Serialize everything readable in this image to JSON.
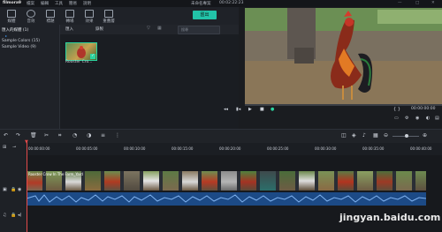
{
  "titlebar": {
    "brand": "filmora9",
    "menus": [
      "檔案",
      "編輯",
      "工具",
      "簡易",
      "說明"
    ],
    "project": "未命名專案",
    "timecode": "00:02:22:23"
  },
  "toolbar": {
    "items": [
      {
        "label": "媒體",
        "icon": "folder-icon"
      },
      {
        "label": "音效",
        "icon": "music-icon"
      },
      {
        "label": "標題",
        "icon": "text-icon"
      },
      {
        "label": "轉場",
        "icon": "transition-icon"
      },
      {
        "label": "效果",
        "icon": "effects-icon"
      },
      {
        "label": "重疊層",
        "icon": "overlay-icon"
      }
    ],
    "export_label": "匯出"
  },
  "tree": {
    "header": "匯入的媒體 (1)",
    "items": [
      "Sample Colors (15)",
      "Sample Video (9)"
    ]
  },
  "bin": {
    "import_label": "匯入",
    "record_label": "錄製",
    "search_placeholder": "搜尋",
    "media_item": "Rooster Cro..."
  },
  "preview": {
    "time": "00:00:00:00"
  },
  "timeline": {
    "ticks": [
      "00:00:00:00",
      "00:00:05:00",
      "00:00:10:00",
      "00:00:15:00",
      "00:00:20:00",
      "00:00:25:00",
      "00:00:30:00",
      "00:00:35:00",
      "00:00:40:00"
    ],
    "clip_label": "Rooster Crow In The Farm_Yard"
  },
  "watermark": "jingyan.baidu.com"
}
